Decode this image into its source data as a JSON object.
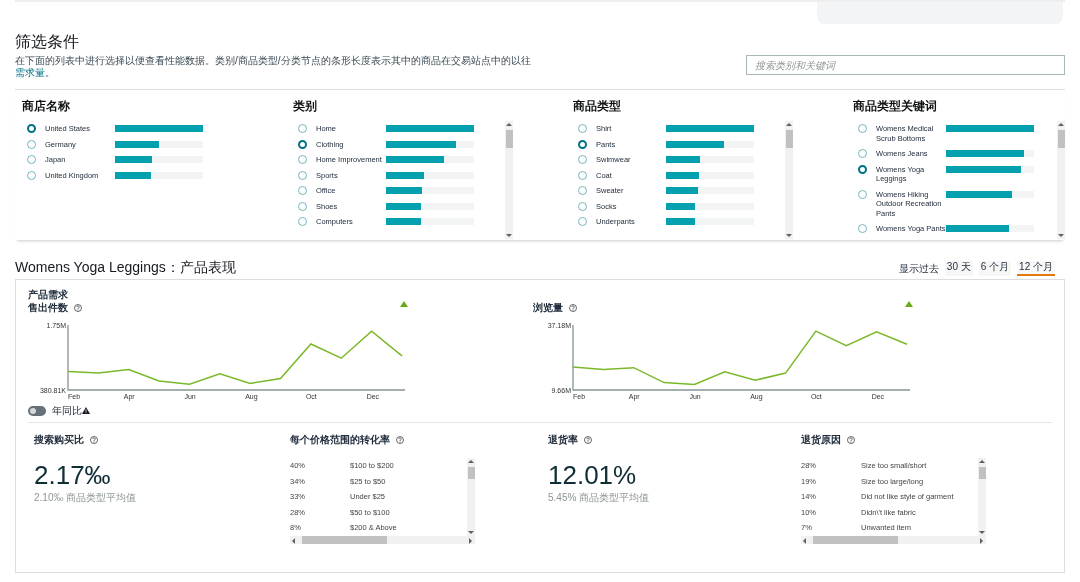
{
  "filters": {
    "title": "筛选条件",
    "description": "在下面的列表中进行选择以便查看性能数据。类别/商品类型/分类节点的条形长度表示其中的商品在交易站点中的以往",
    "description_link": "需求量",
    "description_end": "。",
    "search": {
      "placeholder": "搜索类别和关键词"
    },
    "columns": [
      {
        "title": "商店名称",
        "scrollable": false,
        "items": [
          {
            "label": "United States",
            "selected": true,
            "level": 1
          },
          {
            "label": "Germany",
            "selected": false,
            "level": 0.5
          },
          {
            "label": "Japan",
            "selected": false,
            "level": 0.42
          },
          {
            "label": "United Kingdom",
            "selected": false,
            "level": 0.41
          }
        ]
      },
      {
        "title": "类别",
        "scrollable": true,
        "items": [
          {
            "label": "Home",
            "selected": false,
            "level": 1
          },
          {
            "label": "Clothing",
            "selected": true,
            "level": 0.8
          },
          {
            "label": "Home Improvement",
            "selected": false,
            "level": 0.66
          },
          {
            "label": "Sports",
            "selected": false,
            "level": 0.43
          },
          {
            "label": "Office",
            "selected": false,
            "level": 0.41
          },
          {
            "label": "Shoes",
            "selected": false,
            "level": 0.4
          },
          {
            "label": "Computers",
            "selected": false,
            "level": 0.4
          }
        ]
      },
      {
        "title": "商品类型",
        "scrollable": true,
        "items": [
          {
            "label": "Shirt",
            "selected": false,
            "level": 1
          },
          {
            "label": "Pants",
            "selected": true,
            "level": 0.66
          },
          {
            "label": "Swimwear",
            "selected": false,
            "level": 0.39
          },
          {
            "label": "Coat",
            "selected": false,
            "level": 0.38
          },
          {
            "label": "Sweater",
            "selected": false,
            "level": 0.36
          },
          {
            "label": "Socks",
            "selected": false,
            "level": 0.33
          },
          {
            "label": "Underpants",
            "selected": false,
            "level": 0.33
          }
        ]
      },
      {
        "title": "商品类型关键词",
        "scrollable": true,
        "items": [
          {
            "label": "Womens Medical Scrub Bottoms",
            "selected": false,
            "level": 1
          },
          {
            "label": "Womens Jeans",
            "selected": false,
            "level": 0.89
          },
          {
            "label": "Womens Yoga Leggings",
            "selected": true,
            "level": 0.85
          },
          {
            "label": "Womens Hiking Outdoor Recreation Pants",
            "selected": false,
            "level": 0.75
          },
          {
            "label": "Womens Yoga Pants",
            "selected": false,
            "level": 0.72
          }
        ]
      }
    ]
  },
  "performance": {
    "title": "Womens Yoga Leggings：产品表现",
    "period_label": "显示过去",
    "periods": [
      {
        "label": "30 天",
        "selected": false
      },
      {
        "label": "6 个月",
        "selected": false
      },
      {
        "label": "12 个月",
        "selected": true
      }
    ],
    "demand": {
      "title": "产品需求",
      "charts": [
        {
          "title": "售出件数",
          "trend_up": true,
          "chart_data": {
            "type": "line",
            "categories": [
              "Feb",
              null,
              "Apr",
              null,
              "Jun",
              null,
              "Aug",
              null,
              "Oct",
              null,
              "Dec",
              null
            ],
            "ylim": [
              380810,
              1750000
            ],
            "yticks": [
              {
                "value": 380810,
                "label": "380.81K"
              },
              {
                "value": 1750000,
                "label": "1.75M"
              }
            ],
            "series": [
              {
                "color": "#7ab829",
                "values": [
                  770000,
                  740000,
                  810000,
                  570000,
                  500000,
                  720000,
                  520000,
                  620000,
                  1350000,
                  1050000,
                  1620000,
                  1100000
                ]
              }
            ]
          }
        },
        {
          "title": "浏览量",
          "trend_up": true,
          "chart_data": {
            "type": "line",
            "categories": [
              "Feb",
              null,
              "Apr",
              null,
              "Jun",
              null,
              "Aug",
              null,
              "Oct",
              null,
              "Dec",
              null
            ],
            "ylim": [
              9.66,
              37.18
            ],
            "yticks": [
              {
                "value": 9.66,
                "label": "9.66M"
              },
              {
                "value": 37.18,
                "label": "37.18M"
              }
            ],
            "series": [
              {
                "color": "#7ab829",
                "values": [
                  19.4,
                  18.3,
                  19.1,
                  12.8,
                  12,
                  17.4,
                  13.8,
                  16.8,
                  34.6,
                  28.4,
                  34.3,
                  29
                ]
              }
            ]
          }
        }
      ]
    },
    "yoy_toggle": {
      "label": "年同比",
      "on": false
    },
    "metrics": [
      {
        "kind": "stat",
        "title": "搜索购买比",
        "value": "2.17‰",
        "average": "2.10‰ 商品类型平均值"
      },
      {
        "kind": "table",
        "title": "每个价格范围的转化率",
        "rows": [
          {
            "percent": "40%",
            "label": "$100 to $200"
          },
          {
            "percent": "34%",
            "label": "$25 to $50"
          },
          {
            "percent": "33%",
            "label": "Under $25"
          },
          {
            "percent": "28%",
            "label": "$50 to $100"
          },
          {
            "percent": "8%",
            "label": "$200 & Above"
          }
        ]
      },
      {
        "kind": "stat",
        "title": "退货率",
        "value": "12.01%",
        "average": "5.45% 商品类型平均值"
      },
      {
        "kind": "table",
        "title": "退货原因",
        "rows": [
          {
            "percent": "28%",
            "label": "Size too small/short"
          },
          {
            "percent": "19%",
            "label": "Size too large/long"
          },
          {
            "percent": "14%",
            "label": "Did not like style of garment"
          },
          {
            "percent": "10%",
            "label": "Didn\\'t like fabric"
          },
          {
            "percent": "7%",
            "label": "Unwanted item"
          }
        ]
      }
    ]
  }
}
